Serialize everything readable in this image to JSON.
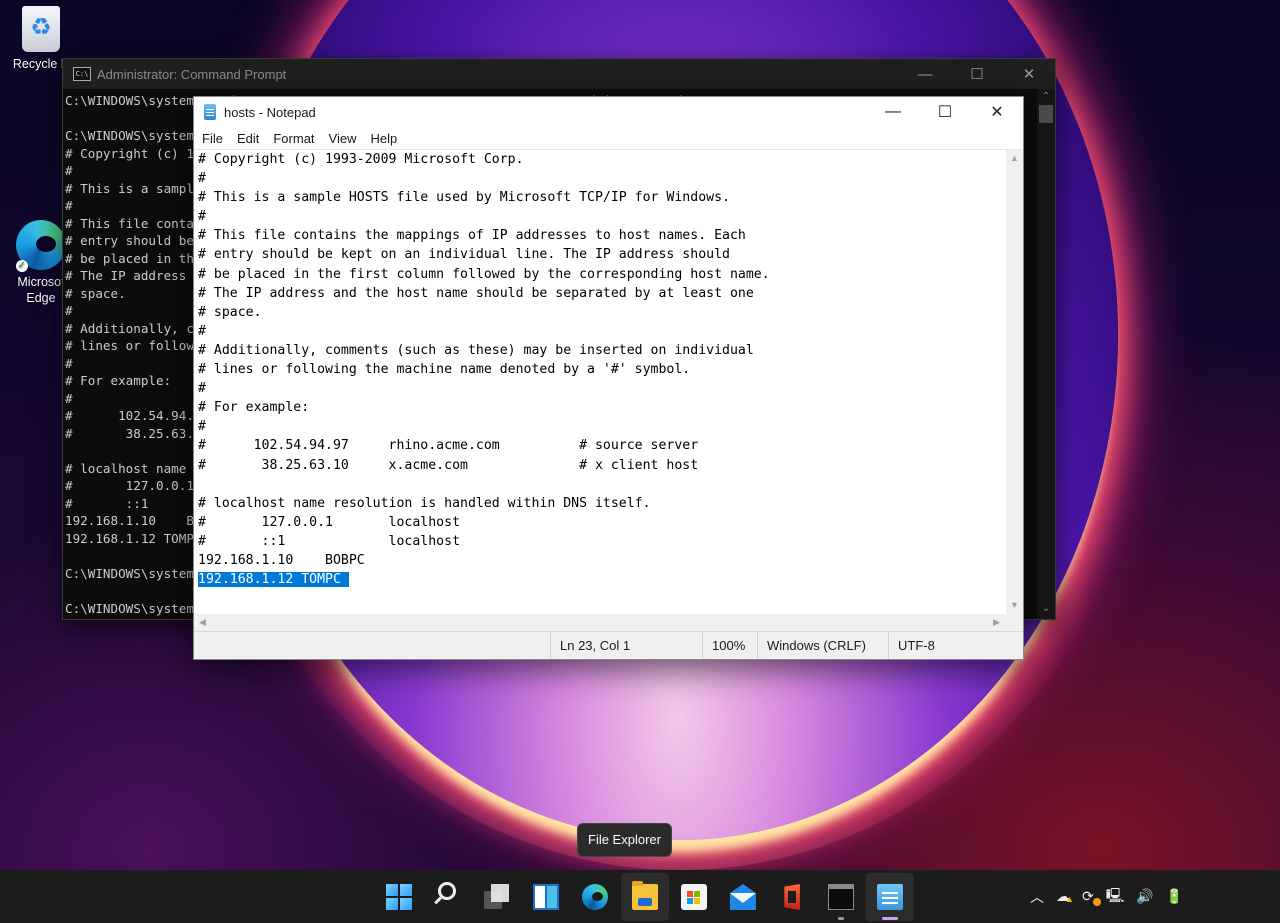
{
  "desktop": {
    "icons": [
      {
        "label": "Recycle Bin",
        "visible_label": "Recycle B",
        "icon": "recycle-bin-icon"
      },
      {
        "label": "Microsoft Edge",
        "visible_label_1": "Microsof",
        "visible_label_2": "Edge",
        "icon": "edge-icon"
      }
    ]
  },
  "cmd": {
    "title": "Administrator: Command Prompt",
    "buttons": {
      "minimize": "—",
      "maximize": "☐",
      "close": "✕"
    },
    "lines": [
      "C:\\WINDOWS\\system32>echo 192.168.1.12 TOMPC >> %SystemRoot%\\System32\\drivers\\etc\\hosts",
      "",
      "C:\\WINDOWS\\system32>type %SystemRoot%\\System32\\drivers\\etc\\hosts",
      "# Copyright (c) 1993-2009 Microsoft Corp.",
      "#",
      "# This is a sample HOSTS file used by Microsoft TCP/IP for Windows.",
      "#",
      "# This file contains the mappings of IP addresses to host names. Each",
      "# entry should be kept on an individual line. The IP address should",
      "# be placed in the first column followed by the corresponding host name.",
      "# The IP address and the host name should be separated by at least one",
      "# space.",
      "#",
      "# Additionally, comments (such as these) may be inserted on individual",
      "# lines or following the machine name denoted by a '#' symbol.",
      "#",
      "# For example:",
      "#",
      "#      102.54.94.97     rhino.acme.com          # source server",
      "#       38.25.63.10     x.acme.com              # x client host",
      "",
      "# localhost name resolution is handled within DNS itself.",
      "#       127.0.0.1       localhost",
      "#       ::1             localhost",
      "192.168.1.10    BOBPC",
      "192.168.1.12 TOMPC",
      "",
      "C:\\WINDOWS\\system32>",
      "",
      "C:\\WINDOWS\\system32>"
    ]
  },
  "notepad": {
    "title": "hosts - Notepad",
    "buttons": {
      "minimize": "—",
      "maximize": "☐",
      "close": "✕"
    },
    "menu": [
      "File",
      "Edit",
      "Format",
      "View",
      "Help"
    ],
    "lines": [
      "# Copyright (c) 1993-2009 Microsoft Corp.",
      "#",
      "# This is a sample HOSTS file used by Microsoft TCP/IP for Windows.",
      "#",
      "# This file contains the mappings of IP addresses to host names. Each",
      "# entry should be kept on an individual line. The IP address should",
      "# be placed in the first column followed by the corresponding host name.",
      "# The IP address and the host name should be separated by at least one",
      "# space.",
      "#",
      "# Additionally, comments (such as these) may be inserted on individual",
      "# lines or following the machine name denoted by a '#' symbol.",
      "#",
      "# For example:",
      "#",
      "#      102.54.94.97     rhino.acme.com          # source server",
      "#       38.25.63.10     x.acme.com              # x client host",
      "",
      "# localhost name resolution is handled within DNS itself.",
      "#       127.0.0.1       localhost",
      "#       ::1             localhost",
      "192.168.1.10    BOBPC"
    ],
    "selected_line": "192.168.1.12 TOMPC ",
    "status": {
      "position": "Ln 23, Col 1",
      "zoom": "100%",
      "line_ending": "Windows (CRLF)",
      "encoding": "UTF-8"
    },
    "selection_color": "#0078d7"
  },
  "tooltip": "File Explorer",
  "taskbar": {
    "apps": [
      {
        "name": "Start",
        "icon": "windows-start-icon"
      },
      {
        "name": "Search",
        "icon": "search-icon"
      },
      {
        "name": "Task View",
        "icon": "task-view-icon"
      },
      {
        "name": "Widgets",
        "icon": "widgets-icon"
      },
      {
        "name": "Microsoft Edge",
        "icon": "edge-icon"
      },
      {
        "name": "File Explorer",
        "icon": "folder-icon",
        "state": "hover"
      },
      {
        "name": "Microsoft Store",
        "icon": "store-icon"
      },
      {
        "name": "Mail",
        "icon": "mail-icon"
      },
      {
        "name": "Office",
        "icon": "office-icon"
      },
      {
        "name": "Command Prompt",
        "icon": "terminal-icon",
        "state": "running"
      },
      {
        "name": "Notepad",
        "icon": "notepad-icon",
        "state": "active"
      }
    ],
    "tray": [
      "chevron-up-icon",
      "onedrive-warning-icon",
      "sync-icon",
      "network-icon",
      "volume-icon",
      "battery-charging-icon"
    ],
    "accent_color": "#d29ff7"
  }
}
